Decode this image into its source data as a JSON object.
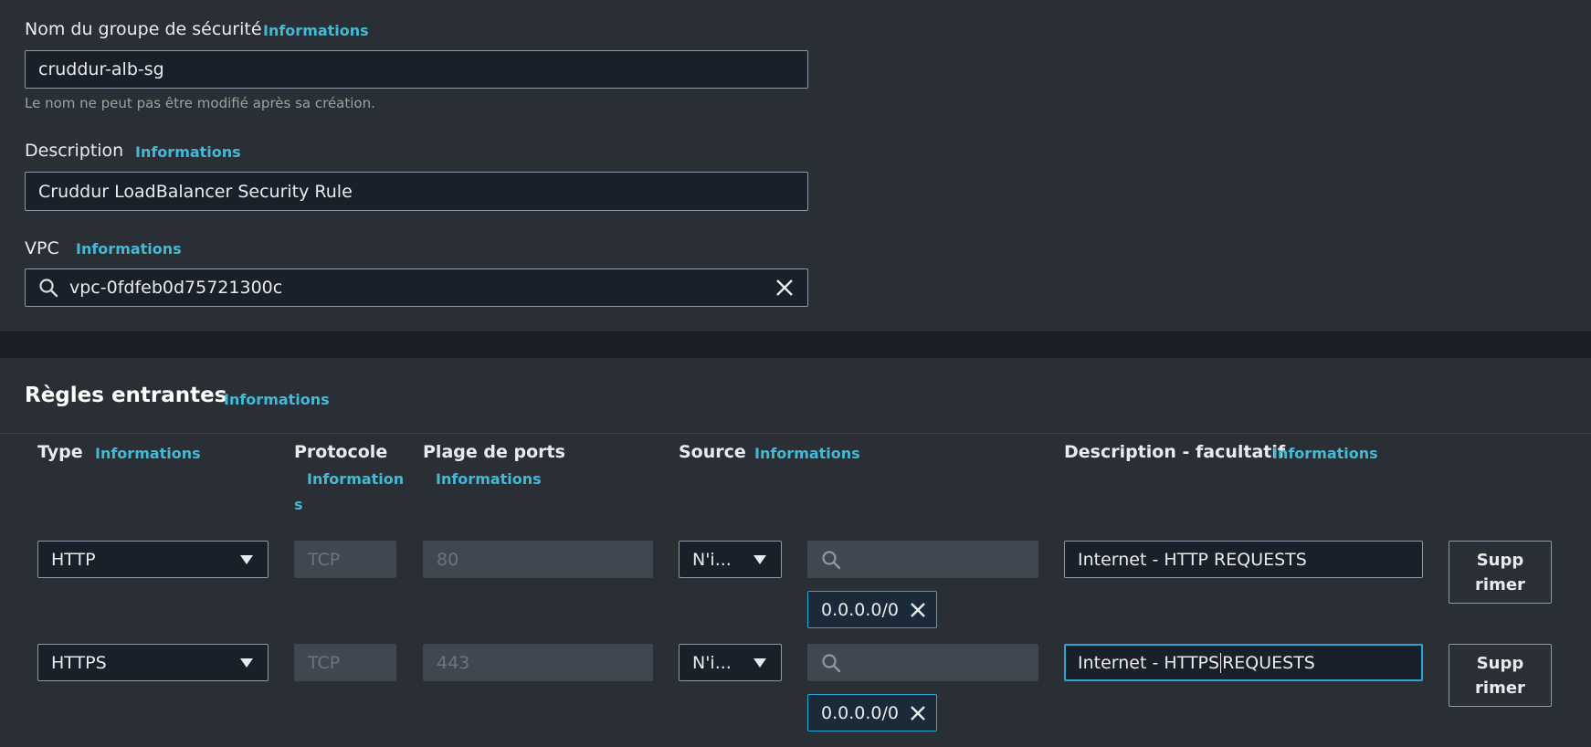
{
  "security_group": {
    "name_label": "Nom du groupe de sécurité",
    "name_info": "Informations",
    "name_value": "cruddur-alb-sg",
    "name_hint": "Le nom ne peut pas être modifié après sa création.",
    "description_label": "Description",
    "description_info": "Informations",
    "description_value": "Cruddur LoadBalancer Security Rule",
    "vpc_label": "VPC",
    "vpc_info": "Informations",
    "vpc_value": "vpc-0fdfeb0d75721300c"
  },
  "inbound_rules": {
    "title": "Règles entrantes",
    "title_info": "Informations",
    "columns": {
      "type": "Type",
      "type_info": "Informations",
      "protocol": "Protocole",
      "protocol_info_line1": "Information",
      "protocol_info_line2": "s",
      "port_range": "Plage de ports",
      "port_range_info": "Informations",
      "source": "Source",
      "source_info": "Informations",
      "description": "Description - facultatif",
      "description_info": "Informations"
    },
    "rules": [
      {
        "type": "HTTP",
        "protocol": "TCP",
        "port": "80",
        "source_type": "N'i...",
        "cidr": "0.0.0.0/0",
        "description": "Internet - HTTP REQUESTS",
        "delete_line1": "Supp",
        "delete_line2": "rimer"
      },
      {
        "type": "HTTPS",
        "protocol": "TCP",
        "port": "443",
        "source_type": "N'i...",
        "cidr": "0.0.0.0/0",
        "description_before_cursor": "Internet - HTTPS",
        "description_after_cursor": "REQUESTS",
        "delete_line1": "Supp",
        "delete_line2": "rimer"
      }
    ]
  },
  "colors": {
    "background": "#2a2e35",
    "input_bg": "#1a2029",
    "link": "#44b9d6",
    "focus": "#2aa6d9"
  },
  "icons": [
    "search-icon",
    "clear-icon",
    "caret-down-icon",
    "remove-token-icon"
  ]
}
